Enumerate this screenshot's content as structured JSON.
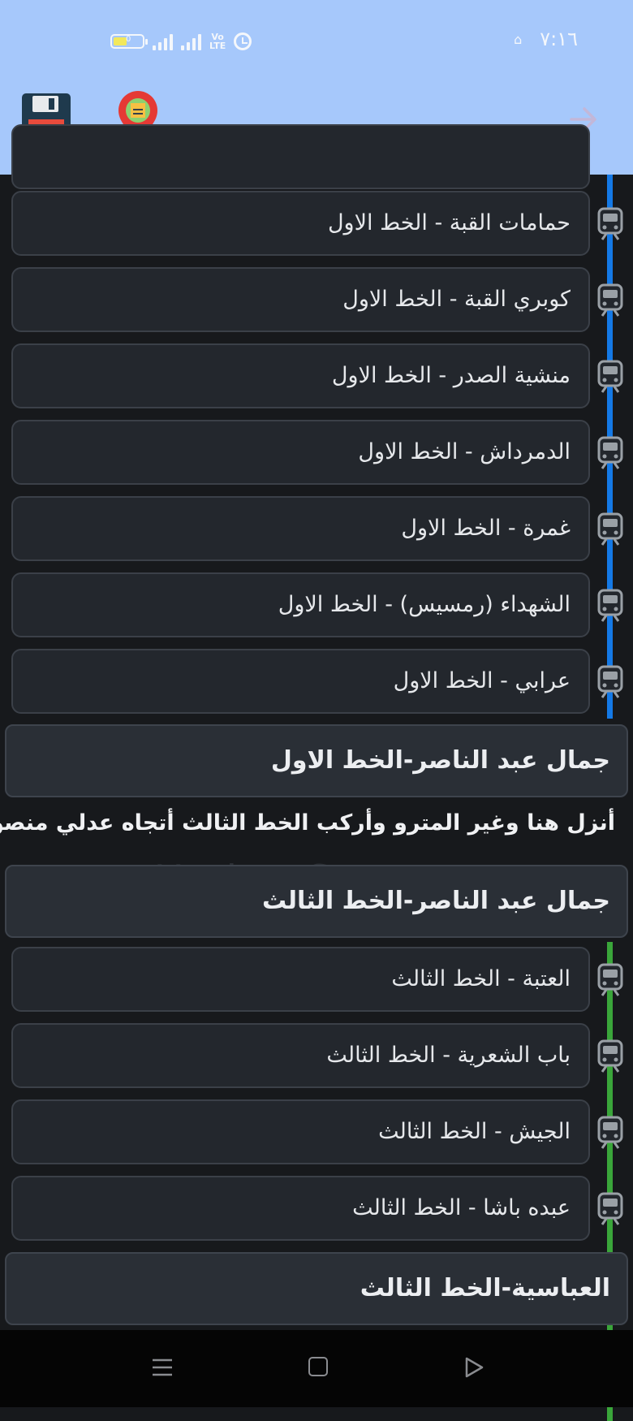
{
  "status_bar": {
    "time": "٧:١٦",
    "battery_text": "0",
    "network_label_top": "Vo",
    "network_label_bottom": "LTE"
  },
  "colors": {
    "header_bg": "#a6c8fb",
    "line1": "#1479e6",
    "line3": "#3aa63a",
    "card_bg": "#23272d"
  },
  "header": {
    "save_icon": "floppy-disk-icon",
    "map_icon": "map-pin-route-icon",
    "forward_icon": "arrow-right-icon"
  },
  "route": {
    "line1_stations": [
      "حمامات القبة - الخط الاول",
      "كوبري القبة - الخط الاول",
      "منشية الصدر - الخط الاول",
      "الدمرداش - الخط الاول",
      "غمرة - الخط الاول",
      "الشهداء (رمسيس) - الخط الاول",
      "عرابي - الخط الاول"
    ],
    "transfer_1": "جمال عبد الناصر-الخط الاول",
    "instruction": "أنزل هنا وغير المترو وأركب الخط الثالث أتجاه عدلي منصور",
    "transfer_2": "جمال عبد الناصر-الخط الثالث",
    "line3_stations": [
      "العتبة - الخط الثالث",
      "باب الشعرية - الخط الثالث",
      "الجيش - الخط الثالث",
      "عبده باشا - الخط الثالث"
    ],
    "transfer_3": "العباسية-الخط الثالث"
  },
  "watermark": "UpdateStar.com"
}
